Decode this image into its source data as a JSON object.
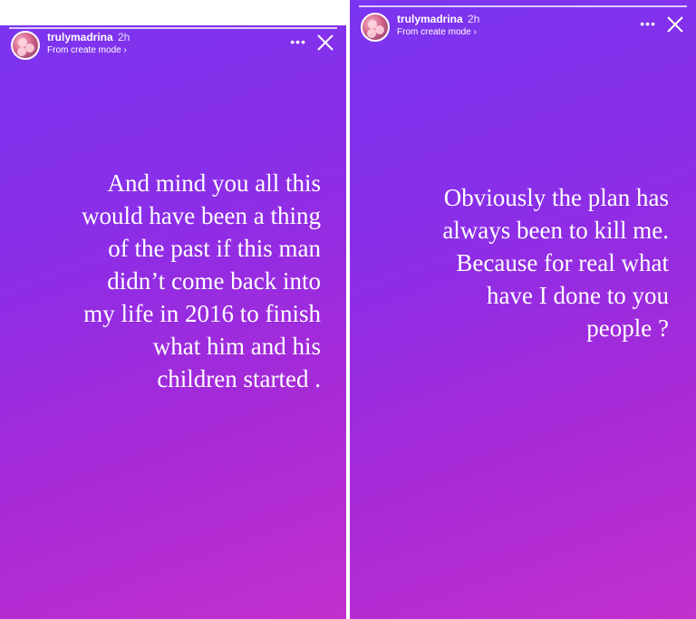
{
  "colors": {
    "gradient_top": "#7a35f0",
    "gradient_bottom": "#c22fcd",
    "text": "#ffffff",
    "highlight_mark": "#e0344d"
  },
  "stories": [
    {
      "username": "trulymadrina",
      "time": "2h",
      "mode_label": "From create mode ›",
      "more_icon": "more-icon",
      "close_icon": "close-icon",
      "text_lines": [
        "And mind you all this",
        "would have been a thing",
        "of the past if this man",
        "didn’t come back into",
        "my life in 2016 to finish",
        "what him and his",
        "children started ."
      ]
    },
    {
      "username": "trulymadrina",
      "time": "2h",
      "mode_label": "From create mode ›",
      "more_icon": "more-icon",
      "close_icon": "close-icon",
      "text_lines": [
        "Obviously the plan has",
        "always been to kill me.",
        "Because for real what",
        "have I done to you",
        "people ?"
      ]
    }
  ]
}
